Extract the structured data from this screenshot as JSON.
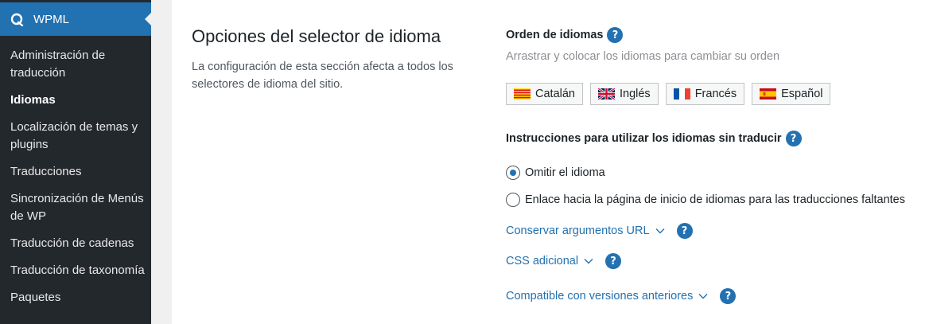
{
  "sidebar": {
    "header_label": "WPML",
    "items": [
      {
        "label": "Administración de traducción"
      },
      {
        "label": "Idiomas"
      },
      {
        "label": "Localización de temas y plugins"
      },
      {
        "label": "Traducciones"
      },
      {
        "label": "Sincronización de Menús de WP"
      },
      {
        "label": "Traducción de cadenas"
      },
      {
        "label": "Traducción de taxonomía"
      },
      {
        "label": "Paquetes"
      }
    ],
    "current": "Idiomas"
  },
  "section": {
    "title": "Opciones del selector de idioma",
    "description": "La configuración de esta sección afecta a todos los selectores de idioma del sitio."
  },
  "order": {
    "heading": "Orden de idiomas",
    "hint": "Arrastrar y colocar los idiomas para cambiar su orden",
    "languages": [
      {
        "label": "Catalán",
        "flag": "catalan-flag"
      },
      {
        "label": "Inglés",
        "flag": "uk-flag"
      },
      {
        "label": "Francés",
        "flag": "france-flag"
      },
      {
        "label": "Español",
        "flag": "spain-flag"
      }
    ]
  },
  "untranslated": {
    "heading": "Instrucciones para utilizar los idiomas sin traducir",
    "options": [
      {
        "label": "Omitir el idioma",
        "checked": true
      },
      {
        "label": "Enlace hacia la página de inicio de idiomas para las traducciones faltantes",
        "checked": false
      }
    ]
  },
  "toggles": [
    {
      "label": "Conservar argumentos URL"
    },
    {
      "label": "CSS adicional"
    },
    {
      "label": "Compatible con versiones anteriores"
    }
  ],
  "help_glyph": "?",
  "colors": {
    "accent": "#2271b1",
    "sidebar_bg": "#23282d"
  }
}
